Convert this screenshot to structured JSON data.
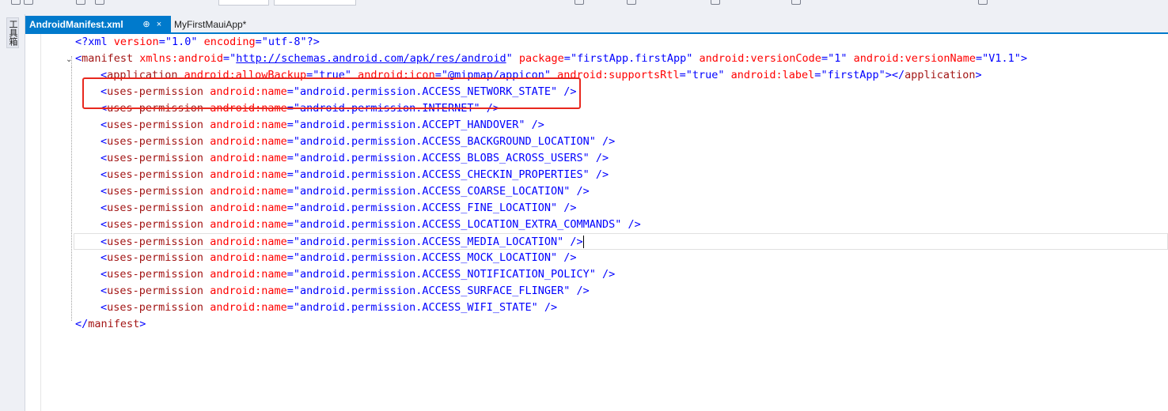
{
  "window": {
    "side_panel_label": "工具箱"
  },
  "tabs": [
    {
      "label": "AndroidManifest.xml",
      "pin": "⊕",
      "close": "×"
    },
    {
      "label": "MyFirstMauiApp*"
    }
  ],
  "xml": {
    "declaration": {
      "open": "<?xml ",
      "version_attr": "version",
      "eq": "=",
      "version_val": "\"1.0\"",
      "encoding_attr": " encoding",
      "encoding_val": "\"utf-8\"",
      "close": "?>"
    },
    "manifest_open": {
      "lt": "<",
      "tag": "manifest",
      "xmlns_attr": " xmlns:android",
      "eq": "=",
      "q1": "\"",
      "xmlns_val": "http://schemas.android.com/apk/res/android",
      "q2": "\"",
      "package_attr": " package",
      "package_val": "\"firstApp.firstApp\"",
      "vcode_attr": " android:versionCode",
      "vcode_val": "\"1\"",
      "vname_attr": " android:versionName",
      "vname_val": "\"V1.1\"",
      "gt": ">"
    },
    "application": {
      "lt": "<",
      "tag": "application",
      "backup_attr": " android:allowBackup",
      "eq": "=",
      "backup_val": "\"true\"",
      "icon_attr": " android:icon",
      "icon_val": "\"@mipmap/appicon\"",
      "rtl_attr": " android:supportsRtl",
      "rtl_val": "\"true\"",
      "label_attr": " android:label",
      "label_val": "\"firstApp\"",
      "gt": ">",
      "close_lt": "</",
      "close_tag": "application",
      "close_gt": ">"
    },
    "permission_tag": "uses-permission",
    "permission_attr": " android:name",
    "permission_eq": "=",
    "permission_prefix": "\"android.permission.",
    "permission_end": "\"",
    "permission_close": " />",
    "permissions": [
      "ACCESS_NETWORK_STATE",
      "INTERNET",
      "ACCEPT_HANDOVER",
      "ACCESS_BACKGROUND_LOCATION",
      "ACCESS_BLOBS_ACROSS_USERS",
      "ACCESS_CHECKIN_PROPERTIES",
      "ACCESS_COARSE_LOCATION",
      "ACCESS_FINE_LOCATION",
      "ACCESS_LOCATION_EXTRA_COMMANDS",
      "ACCESS_MEDIA_LOCATION",
      "ACCESS_MOCK_LOCATION",
      "ACCESS_NOTIFICATION_POLICY",
      "ACCESS_SURFACE_FLINGER",
      "ACCESS_WIFI_STATE"
    ],
    "manifest_close": {
      "lt": "</",
      "tag": "manifest",
      "gt": ">"
    },
    "highlight_color": "#e8281e",
    "current_line_permission": "ACCESS_MEDIA_LOCATION"
  },
  "colors": {
    "tab_active": "#007acc",
    "tag": "#a31515",
    "attribute": "#ff0000",
    "value": "#0000ff"
  }
}
